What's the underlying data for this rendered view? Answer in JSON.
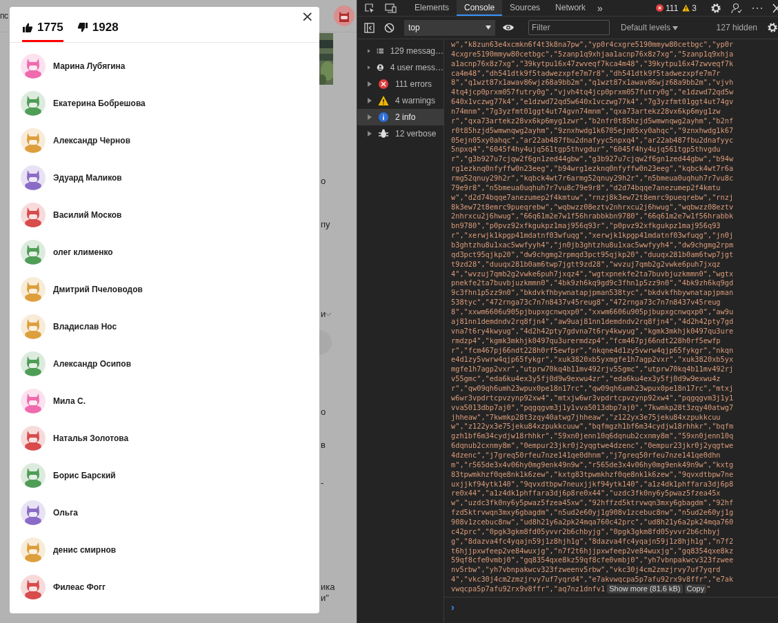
{
  "background_page": {
    "header_text": "пс",
    "fragments": [
      "о",
      "пу",
      "и",
      "о",
      "в",
      "-",
      "ика",
      "и\""
    ]
  },
  "likes_dialog": {
    "close": "×",
    "tabs": [
      {
        "kind": "like",
        "label": "1775",
        "selected": true
      },
      {
        "kind": "dislike",
        "label": "1928",
        "selected": false
      }
    ],
    "users": [
      {
        "name": "Марина Лубягина",
        "color": "#f06aae"
      },
      {
        "name": "Екатерина Бобрешова",
        "color": "#4f9d57"
      },
      {
        "name": "Александр Чернов",
        "color": "#dd9f3c"
      },
      {
        "name": "Эдуард Маликов",
        "color": "#8a6cc6"
      },
      {
        "name": "Василий Москов",
        "color": "#d84c4c"
      },
      {
        "name": "олег клименко",
        "color": "#4f9d57"
      },
      {
        "name": "Дмитрий Пчеловодов",
        "color": "#dd9f3c"
      },
      {
        "name": "Владислав Нос",
        "color": "#dd9f3c"
      },
      {
        "name": "Александр Осипов",
        "color": "#4f9d57"
      },
      {
        "name": "Мила С.",
        "color": "#f06aae"
      },
      {
        "name": "Наталья Золотова",
        "color": "#d84c4c"
      },
      {
        "name": "Борис Барский",
        "color": "#4f9d57"
      },
      {
        "name": "Ольга",
        "color": "#8a6cc6"
      },
      {
        "name": "денис смирнов",
        "color": "#dd9f3c"
      },
      {
        "name": "Филеас Фогг",
        "color": "#d84c4c"
      }
    ]
  },
  "devtools": {
    "tabs": [
      {
        "label": "Elements",
        "selected": false
      },
      {
        "label": "Console",
        "selected": true
      },
      {
        "label": "Sources",
        "selected": false
      },
      {
        "label": "Network",
        "selected": false
      }
    ],
    "more": "»",
    "error_count": "111",
    "warning_count": "3",
    "context": "top",
    "filter": {
      "placeholder": "Filter"
    },
    "levels": "Default levels",
    "hidden": "127 hidden",
    "sidebar": [
      {
        "kind": "messages",
        "label": "129 messag…",
        "selected": false
      },
      {
        "kind": "user",
        "label": "4 user mess…",
        "selected": false
      },
      {
        "kind": "errors",
        "label": "111 errors",
        "selected": false
      },
      {
        "kind": "warnings",
        "label": "4 warnings",
        "selected": false
      },
      {
        "kind": "info",
        "label": "2 info",
        "selected": true
      },
      {
        "kind": "verbose",
        "label": "12 verbose",
        "selected": false
      }
    ],
    "console": {
      "lines": [
        "w\",\"k8zun63e4xcmkn6f4t3k8na7pw\",\"yp0r4cxgre5190mmyw80cetbgc\",\"yp0r",
        "4cxgre5190mmyw80cetbgc\",\"5zanp1q9xhjaa1acnp76x8z7xg\",\"5zanp1q9xhja",
        "a1acnp76x8z7xg\",\"39kytpu16x47zwveqf7kca4m48\",\"39kytpu16x47zwveqf7k",
        "ca4m48\",\"dh541dtk9f5tadwezxpfe7m7r8\",\"dh541dtk9f5tadwezxpfe7m7r",
        "8\",\"q1wzt87x1awav86wjz68a9bb2m\",\"q1wzt87x1awav86wjz68a9bb2m\",\"vjvh",
        "4tq4jcp0prxm057futry0g\",\"vjvh4tq4jcp0prxm057futry0g\",\"e1dzwd72qd5w",
        "640x1vczwg77k4\",\"e1dzwd72qd5w640x1vczwg77k4\",\"7g3yzfmt01ggt4ut74gv",
        "n74mnm\",\"7g3yzfmt01ggt4ut74gvn74mnm\",\"qxa73artekz28vx6kp6myg1zw",
        "r\",\"qxa73artekz28vx6kp6myg1zwr\",\"b2nfr0t85hzjd5wmwnqwg2ayhm\",\"b2nf",
        "r0t85hzjd5wmwnqwg2ayhm\",\"9znxhwdg1k6705ejn05xy0ahqc\",\"9znxhwdg1k67",
        "05ejn05xy0ahqc\",\"ar22ab487fbu2dnafyyc5npxq4\",\"ar22ab487fbu2dnafyyc",
        "5npxq4\",\"6045f4hy4ujq561tgp5thvgdur\",\"6045f4hy4ujq561tgp5thvgdu",
        "r\",\"g3b927u7cjqw2f6gn1zed44gbw\",\"g3b927u7cjqw2f6gn1zed44gbw\",\"b94w",
        "rg1ezknq0nfyffw0n23eeg\",\"b94wrg1ezknq0nfyffw0n23eeg\",\"kqbck4wt7r6a",
        "rmg52qnuy29h2r\",\"kqbck4wt7r6armg52qnuy29h2r\",\"n5bmeua0uqhuh7r7vu8c",
        "79e9r8\",\"n5bmeua0uqhuh7r7vu8c79e9r8\",\"d2d74bqqe7anezumep2f4kmtu",
        "w\",\"d2d74bqqe7anezumep2f4kmtuw\",\"rnzj8k3ew72t8emrc9pueqrebw\",\"rnzj",
        "8k3ew72t8emrc9pueqrebw\",\"wqbwzz08eztv2nhrxcu2j6hwug\",\"wqbwzz08eztv",
        "2nhrxcu2j6hwug\",\"66q61m2e7w1f56hrabbkbn9780\",\"66q61m2e7w1f56hrabbk",
        "bn9780\",\"p0pvz92xfkgukpz1maj956q93r\",\"p0pvz92xfkgukpz1maj956q93",
        "r\",\"xerwjk1kpgp41mdatnf03wfuqg\",\"xerwjk1kpgp41mdatnf03wfuqg\",\"jn0j",
        "b3ghtzhu8u1xac5wwfyyh4\",\"jn0jb3ghtzhu8u1xac5wwfyyh4\",\"dw9chgmg2rpm",
        "qd3pct95qjkp20\",\"dw9chgmg2rpmqd3pct95qjkp20\",\"duuqx281b0am6twp7jgt",
        "t9zd28\",\"duuqx281b0am6twp7jgtt9zd28\",\"wvzuj7qmb2g2vwke6puh7jxqz",
        "4\",\"wvzuj7qmb2g2vwke6puh7jxqz4\",\"wgtxpnekfe2ta7buvbjuzkmmn0\",\"wgtx",
        "pnekfe2ta7buvbjuzkmmn0\",\"4bk9zh6kq9gd9c3fhn1p5zz9n0\",\"4bk9zh6kq9gd",
        "9c3fhn1p5zz9n0\",\"bkdvkfhbywnatapjpman538tyc\",\"bkdvkfhbywnatapjpman",
        "538tyc\",\"472rnga73c7n7n8437v45reug8\",\"472rnga73c7n7n8437v45reug",
        "8\",\"xxwm6606u905pjbupxgcnwqxp0\",\"xxwm6606u905pjbupxgcnwqxp0\",\"aw9u",
        "aj81nn1demdndv2rq8fjn4\",\"aw9uaj81nn1demdndv2rq8fjn4\",\"4d2h42pty7gd",
        "vna7t6ry4kwyug\",\"4d2h42pty7gdvna7t6ry4kwyug\",\"kgmk3mkhjk0497qu3ure",
        "rmdzp4\",\"kgmk3mkhjk0497qu3urermdzp4\",\"fcm467pj66ndt228h0rf5ewfp",
        "r\",\"fcm467pj66ndt228h0rf5ewfpr\",\"nkqne4d1zy5vwrw4qjp65fykgr\",\"nkqn",
        "e4d1zy5vwrw4qjp65fykgr\",\"xuk3820xb5yxmgfe1h7agp2vxr\",\"xuk3820xb5yx",
        "mgfe1h7agp2vxr\",\"utprw70kq4b11mv492rjv55gmc\",\"utprw70kq4b11mv492rj",
        "v55gmc\",\"eda6ku4ex3y5fj0d9w9exwu4zr\",\"eda6ku4ex3y5fj0d9w9exwu4z",
        "r\",\"qw09qh6umh23wpux0pe18n17rc\",\"qw09qh6umh23wpux0pe18n17rc\",\"mtxj",
        "w6wr3vpdrtcpvzynp92xw4\",\"mtxjw6wr3vpdrtcpvzynp92xw4\",\"pqgqgvm3j1y1",
        "vva5013dbp7aj0\",\"pqgqgvm3j1y1vva5013dbp7aj0\",\"7kwmkp28t3zqy40atwg7",
        "jhheaw\",\"7kwmkp28t3zqy40atwg7jhheaw\",\"z122yx3e75jeku84xzpukkcuu",
        "w\",\"z122yx3e75jeku84xzpukkcuuw\",\"bqfmgzh1bf6m34cydjw18rhhkr\",\"bqfm",
        "gzh1bf6m34cydjw18rhhkr\",\"59xn0jenn10q6dqnub2cxnmy8m\",\"59xn0jenn10q",
        "6dqnub2cxnmy8m\",\"0empur23jkr0j2yqgtwe4dzenc\",\"0empur23jkr0j2yqgtwe",
        "4dzenc\",\"j7greq50rfeu7nze141qe0dhnm\",\"j7greq50rfeu7nze141qe0dhn",
        "m\",\"r565de3x4v06hy0mg9enk49n9w\",\"r565de3x4v06hy0mg9enk49n9w\",\"kxtg",
        "83tpwmkhzf0qe8nk1k6zew\",\"kxtg83tpwmkhzf0qe8nk1k6zew\",\"9qvxdtbpw7ne",
        "uxjjkf94ytk140\",\"9qvxdtbpw7neuxjjkf94ytk140\",\"a1z4dk1phffara3dj6p8",
        "re0x44\",\"a1z4dk1phffara3dj6p8re0x44\",\"uzdc3fk0ny6y5pwaz5fzea45x",
        "w\",\"uzdc3fk0ny6y5pwaz5fzea45xw\",\"92hffzd5ktrvwqn3mxy6gbagdm\",\"92hf",
        "fzd5ktrvwqn3mxy6gbagdm\",\"n5ud2e60yj1g908v1zcebuc8nw\",\"n5ud2e60yj1g",
        "908v1zcebuc8nw\",\"ud8h21y6a2pk24mqa760c42prc\",\"ud8h21y6a2pk24mqa760",
        "c42prc\",\"0pgk3gkm8fd05yvvr2b6chbyjg\",\"0pgk3gkm8fd05yvvr2b6chbyj",
        "g\",\"8dazva4fc4yqajn59j1z8hjh1g\",\"8dazva4fc4yqajn59j1z8hjh1g\",\"n7f2",
        "t6hjjpxwfeep2ve84wuxjg\",\"n7f2t6hjjpxwfeep2ve84wuxjg\",\"gq8354qxe8kz",
        "59qf8cfe0vmbj0\",\"gq8354qxe8kz59qf8cfe0vmbj0\",\"yh7vbnpakwcv323fzwee",
        "nv5rbw\",\"yh7vbnpakwcv323fzweenv5rbw\",\"vkc30j4cm2zmzjrvy7uf7yqrd",
        "4\",\"vkc30j4cm2zmzjrvy7uf7yqrd4\",\"e7akvwqcpa5p7afu92rx9v8ffr\",\"e7ak"
      ],
      "last_line": "vwqcpa5p7afu92rx9v8ffr\",\"aq7nz1dnfv1",
      "show_more": "Show more (81.6 kB)",
      "copy": "Copy",
      "tail": "\"",
      "prompt": "›"
    }
  }
}
